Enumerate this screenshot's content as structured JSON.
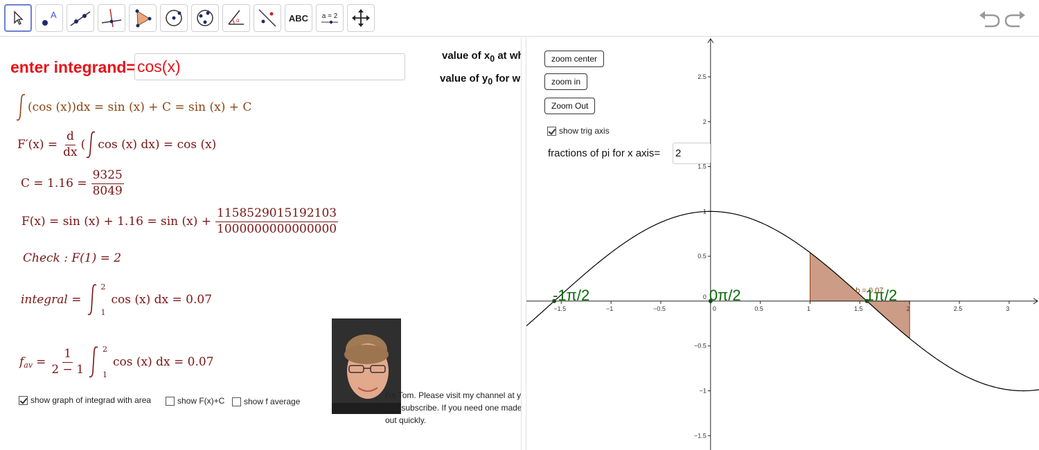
{
  "toolbar": {
    "tools": [
      {
        "name": "move-tool-icon"
      },
      {
        "name": "point-tool-icon"
      },
      {
        "name": "line-tool-icon"
      },
      {
        "name": "perpendicular-tool-icon"
      },
      {
        "name": "polygon-tool-icon"
      },
      {
        "name": "circle-tool-icon"
      },
      {
        "name": "ellipse-tool-icon"
      },
      {
        "name": "angle-tool-icon"
      },
      {
        "name": "reflect-tool-icon"
      },
      {
        "name": "text-tool-icon",
        "label": "ABC"
      },
      {
        "name": "slider-tool-icon",
        "label": "a = 2"
      },
      {
        "name": "move-view-tool-icon"
      }
    ],
    "active_tool": "move-tool-icon"
  },
  "left": {
    "integrand_label": "enter integrand=",
    "integrand_value": "cos(x)",
    "x0_label": "value of x",
    "x0_sub": "0",
    "x0_rest": " at wh",
    "y0_label": "value of y",
    "y0_sub": "0",
    "y0_rest": " for wh",
    "f1_body": "(cos (x))dx = sin (x) + C = sin (x) + C",
    "f2_lhs": "F′(x) =",
    "f2_d": "d",
    "f2_dx": "dx",
    "f2_open": "(",
    "f2_body": "cos (x) dx) = cos (x)",
    "f3_lhs": "C = 1.16 =",
    "f3_num": "9325",
    "f3_den": "8049",
    "f4_lhs": "F(x) = sin (x) + 1.16 = sin (x) +",
    "f4_num": "1158529015192103",
    "f4_den": "1000000000000000",
    "f5": "Check : F(1) = 2",
    "f6_lhs": "integral =",
    "f6_upper": "2",
    "f6_lower": "1",
    "f6_body": "cos (x) dx = 0.07",
    "f7_lhs": "f",
    "f7_sub": "av",
    "f7_eq": "=",
    "f7_num": "1",
    "f7_den": "2 − 1",
    "f7_upper": "2",
    "f7_lower": "1",
    "f7_body": "cos (x) dx = 0.07",
    "checkboxes": [
      {
        "label": "show graph of integrad with area",
        "checked": true
      },
      {
        "label": "show F(x)+C",
        "checked": false
      },
      {
        "label": "show f average",
        "checked": false
      }
    ],
    "bio_line1": "I'm Tom. Please visit my channel at y",
    "bio_line2": "and subscribe. If you need one made",
    "bio_line3": "out quickly."
  },
  "right": {
    "zoom_center": "zoom center",
    "zoom_in": "zoom in",
    "zoom_out": "Zoom Out",
    "trig_axis_label": "show trig axis",
    "trig_axis_checked": true,
    "fractions_label": "fractions of pi for x axis=",
    "fractions_value": "2",
    "b_label": "b = 0.07",
    "pi_labels": [
      {
        "text": "-1π/2",
        "x": -1.5708
      },
      {
        "text": "0π/2",
        "x": 0
      },
      {
        "text": "1π/2",
        "x": 1.5708
      }
    ]
  },
  "chart_data": {
    "type": "line",
    "function": "cos(x)",
    "xlim": [
      -1.85,
      3.3
    ],
    "ylim": [
      -1.66,
      2.94
    ],
    "x_ticks": [
      -1.5,
      -1,
      -0.5,
      0,
      0.5,
      1,
      1.5,
      2,
      2.5,
      3
    ],
    "x_tick_labels": [
      "−1.5",
      "−1",
      "−0.5",
      "0",
      "0.5",
      "1",
      "1.5",
      "2",
      "2.5",
      "3"
    ],
    "y_ticks": [
      -1.5,
      -1,
      -0.5,
      0,
      0.5,
      1,
      1.5,
      2,
      2.5
    ],
    "y_tick_labels": [
      "−1.5",
      "−1",
      "−0.5",
      "0",
      "0.5",
      "1",
      "1.5",
      "2",
      "2.5"
    ],
    "shaded_area": {
      "from": 1,
      "to": 2
    },
    "colors": {
      "curve": "#000000",
      "area": "#c8917a",
      "area_stroke": "#8b4513",
      "pi_label": "#0a6b0a"
    }
  }
}
